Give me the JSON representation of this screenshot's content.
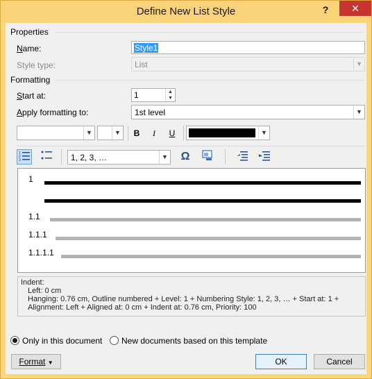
{
  "window": {
    "title": "Define New List Style",
    "help_label": "?",
    "close_label": "✕"
  },
  "properties": {
    "section_label": "Properties",
    "name_label": "Name:",
    "name_value": "Style1",
    "style_type_label": "Style type:",
    "style_type_value": "List"
  },
  "formatting": {
    "section_label": "Formatting",
    "start_at_label": "Start at:",
    "start_at_value": "1",
    "apply_label": "Apply formatting to:",
    "apply_value": "1st level",
    "font_value": "",
    "size_value": "",
    "bold_label": "B",
    "italic_label": "I",
    "underline_label": "U",
    "font_color": "#000000",
    "numbering_style_value": "1, 2, 3, …",
    "symbol_label": "Ω"
  },
  "preview": {
    "levels": [
      {
        "number": "1",
        "line_color": "#000000"
      },
      {
        "number": "1.1",
        "line_color": "#b3b3b3"
      },
      {
        "number": "1.1.1",
        "line_color": "#b3b3b3"
      },
      {
        "number": "1.1.1.1",
        "line_color": "#b3b3b3"
      }
    ]
  },
  "description": {
    "line1": "Indent:",
    "line2": "Left:  0 cm",
    "line3": "Hanging:  0.76 cm, Outline numbered + Level: 1 + Numbering Style: 1, 2, 3, … + Start at: 1 +",
    "line4": "Alignment: Left + Aligned at:  0 cm + Indent at:  0.76 cm, Priority: 100"
  },
  "scope": {
    "option_document": "Only in this document",
    "option_template": "New documents based on this template",
    "selected": "option_document"
  },
  "buttons": {
    "format_label": "Format",
    "ok_label": "OK",
    "cancel_label": "Cancel"
  },
  "colors": {
    "titlebar": "#f9d27a",
    "close": "#c7352f",
    "selection": "#3399ff"
  }
}
